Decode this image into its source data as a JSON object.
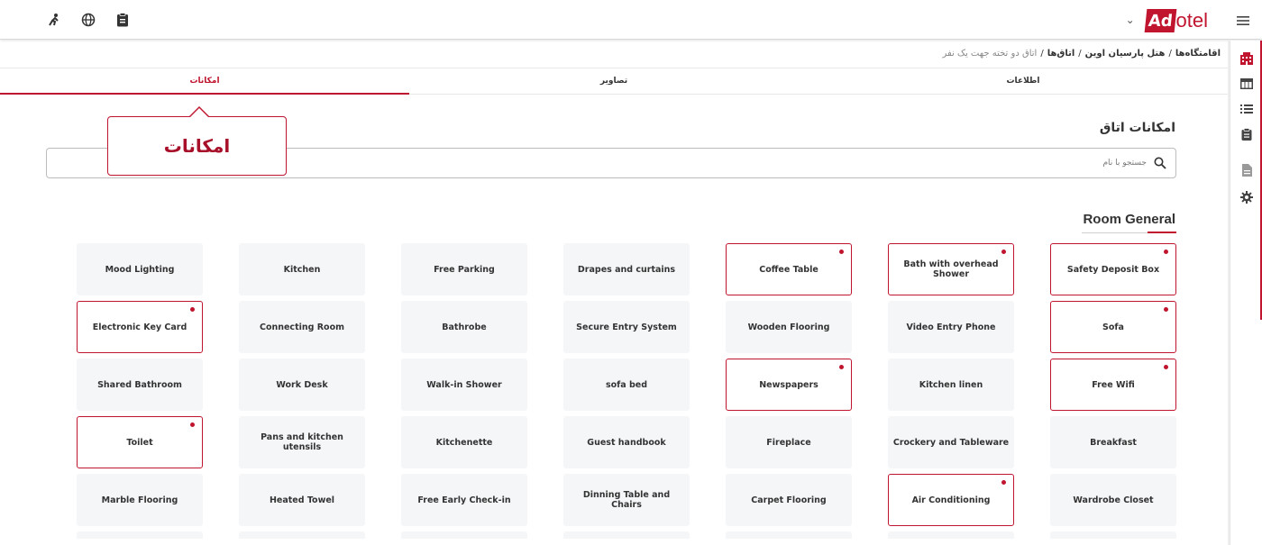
{
  "header": {
    "logo_box": "Ad",
    "logo_rest": "otel",
    "chevron": "⌄",
    "left_icons": [
      "user-run-icon",
      "globe-icon",
      "clipboard-icon"
    ],
    "menu_icon": "hamburger-icon"
  },
  "rail": {
    "icons": [
      "hotel-icon",
      "table-icon",
      "list-icon",
      "clipboard-icon",
      "document-icon",
      "gear-icon"
    ]
  },
  "breadcrumb": {
    "items": [
      "اقامتگاه‌ها",
      "هتل پارسیان اوین",
      "اتاق‌ها"
    ],
    "current": "اتاق دو تخته جهت یک نفر",
    "separator": "/"
  },
  "tabs": [
    {
      "label": "اطلاعات",
      "selected": false
    },
    {
      "label": "تصاویر",
      "selected": false
    },
    {
      "label": "امکانات",
      "selected": true
    }
  ],
  "section": {
    "title": "امکانات اتاق"
  },
  "search": {
    "placeholder": "جستجو با نام",
    "value": ""
  },
  "callout": {
    "text": "امکانات"
  },
  "group": {
    "title": "Room General"
  },
  "amenities": [
    {
      "label": "Safety Deposit Box",
      "selected": true
    },
    {
      "label": "Bath with overhead Shower",
      "selected": true
    },
    {
      "label": "Coffee Table",
      "selected": true
    },
    {
      "label": "Drapes and curtains",
      "selected": false
    },
    {
      "label": "Free Parking",
      "selected": false
    },
    {
      "label": "Kitchen",
      "selected": false
    },
    {
      "label": "Mood Lighting",
      "selected": false
    },
    {
      "label": "Sofa",
      "selected": true
    },
    {
      "label": "Video Entry Phone",
      "selected": false
    },
    {
      "label": "Wooden Flooring",
      "selected": false
    },
    {
      "label": "Secure Entry System",
      "selected": false
    },
    {
      "label": "Bathrobe",
      "selected": false
    },
    {
      "label": "Connecting Room",
      "selected": false
    },
    {
      "label": "Electronic Key Card",
      "selected": true
    },
    {
      "label": "Free Wifi",
      "selected": true
    },
    {
      "label": "Kitchen linen",
      "selected": false
    },
    {
      "label": "Newspapers",
      "selected": true
    },
    {
      "label": "sofa bed",
      "selected": false
    },
    {
      "label": "Walk-in Shower",
      "selected": false
    },
    {
      "label": "Work Desk",
      "selected": false
    },
    {
      "label": "Shared Bathroom",
      "selected": false
    },
    {
      "label": "Breakfast",
      "selected": false
    },
    {
      "label": "Crockery and Tableware",
      "selected": false
    },
    {
      "label": "Fireplace",
      "selected": false
    },
    {
      "label": "Guest handbook",
      "selected": false
    },
    {
      "label": "Kitchenette",
      "selected": false
    },
    {
      "label": "Pans and kitchen utensils",
      "selected": false
    },
    {
      "label": "Toilet",
      "selected": true
    },
    {
      "label": "Wardrobe Closet",
      "selected": false
    },
    {
      "label": "Air Conditioning",
      "selected": true
    },
    {
      "label": "Carpet Flooring",
      "selected": false
    },
    {
      "label": "Dinning Table and Chairs",
      "selected": false
    },
    {
      "label": "Free Early Check-in",
      "selected": false
    },
    {
      "label": "Heated Towel",
      "selected": false
    },
    {
      "label": "Marble Flooring",
      "selected": false
    }
  ],
  "colors": {
    "accent": "#c0142f",
    "card_bg": "#f5f6f8"
  }
}
